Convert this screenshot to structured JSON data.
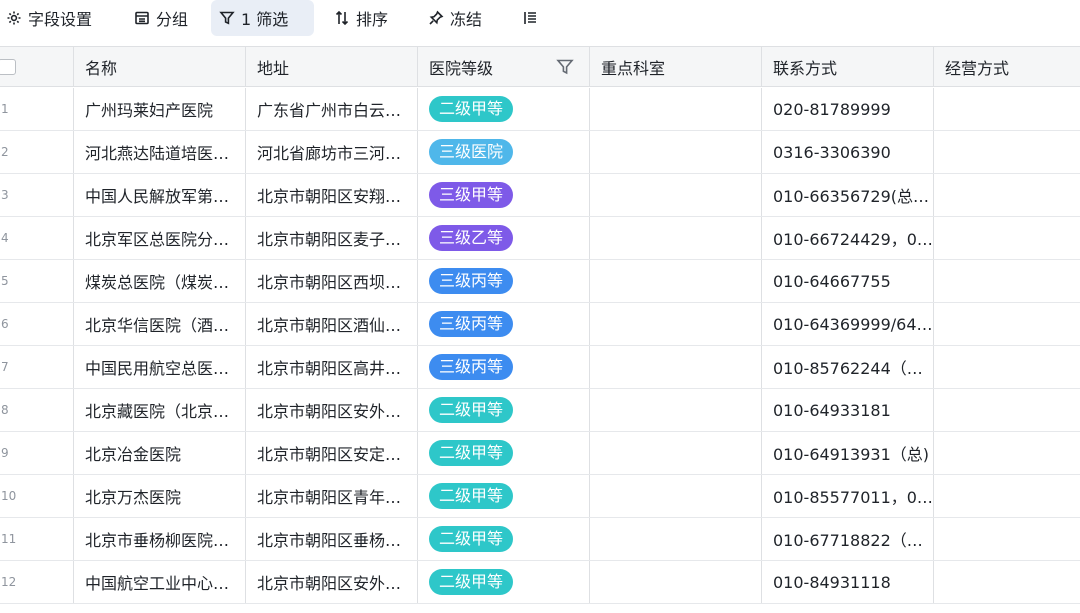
{
  "toolbar": {
    "field_settings": "字段设置",
    "group": "分组",
    "filter": "1 筛选",
    "sort": "排序",
    "freeze": "冻结"
  },
  "columns": {
    "name": "名称",
    "address": "地址",
    "level": "医院等级",
    "dept": "重点科室",
    "contact": "联系方式",
    "mode": "经营方式"
  },
  "rows": [
    {
      "num": "1",
      "name": "广州玛莱妇产医院",
      "address": "广东省广州市白云…",
      "level": "二级甲等",
      "color": "#2ec7c9",
      "dept": "",
      "contact": "020-81789999",
      "mode": ""
    },
    {
      "num": "2",
      "name": "河北燕达陆道培医…",
      "address": "河北省廊坊市三河…",
      "level": "三级医院",
      "color": "#4fb7ea",
      "dept": "",
      "contact": "0316-3306390",
      "mode": ""
    },
    {
      "num": "3",
      "name": "中国人民解放军第…",
      "address": "北京市朝阳区安翔…",
      "level": "三级甲等",
      "color": "#7e5ae8",
      "dept": "",
      "contact": "010-66356729(总…",
      "mode": ""
    },
    {
      "num": "4",
      "name": "北京军区总医院分…",
      "address": "北京市朝阳区麦子…",
      "level": "三级乙等",
      "color": "#7e5ae8",
      "dept": "",
      "contact": "010-66724429，0…",
      "mode": ""
    },
    {
      "num": "5",
      "name": "煤炭总医院（煤炭…",
      "address": "北京市朝阳区西坝…",
      "level": "三级丙等",
      "color": "#3d8cf0",
      "dept": "",
      "contact": "010-64667755",
      "mode": ""
    },
    {
      "num": "6",
      "name": "北京华信医院（酒…",
      "address": "北京市朝阳区酒仙…",
      "level": "三级丙等",
      "color": "#3d8cf0",
      "dept": "",
      "contact": "010-64369999/64…",
      "mode": ""
    },
    {
      "num": "7",
      "name": "中国民用航空总医…",
      "address": "北京市朝阳区高井…",
      "level": "三级丙等",
      "color": "#3d8cf0",
      "dept": "",
      "contact": "010-85762244（…",
      "mode": ""
    },
    {
      "num": "8",
      "name": "北京藏医院（北京…",
      "address": "北京市朝阳区安外…",
      "level": "二级甲等",
      "color": "#2ec7c9",
      "dept": "",
      "contact": "010-64933181",
      "mode": ""
    },
    {
      "num": "9",
      "name": "北京冶金医院",
      "address": "北京市朝阳区安定…",
      "level": "二级甲等",
      "color": "#2ec7c9",
      "dept": "",
      "contact": "010-64913931（总)",
      "mode": ""
    },
    {
      "num": "10",
      "name": "北京万杰医院",
      "address": "北京市朝阳区青年…",
      "level": "二级甲等",
      "color": "#2ec7c9",
      "dept": "",
      "contact": "010-85577011，0…",
      "mode": ""
    },
    {
      "num": "11",
      "name": "北京市垂杨柳医院…",
      "address": "北京市朝阳区垂杨…",
      "level": "二级甲等",
      "color": "#2ec7c9",
      "dept": "",
      "contact": "010-67718822（…",
      "mode": ""
    },
    {
      "num": "12",
      "name": "中国航空工业中心…",
      "address": "北京市朝阳区安外…",
      "level": "二级甲等",
      "color": "#2ec7c9",
      "dept": "",
      "contact": "010-84931118",
      "mode": ""
    }
  ]
}
